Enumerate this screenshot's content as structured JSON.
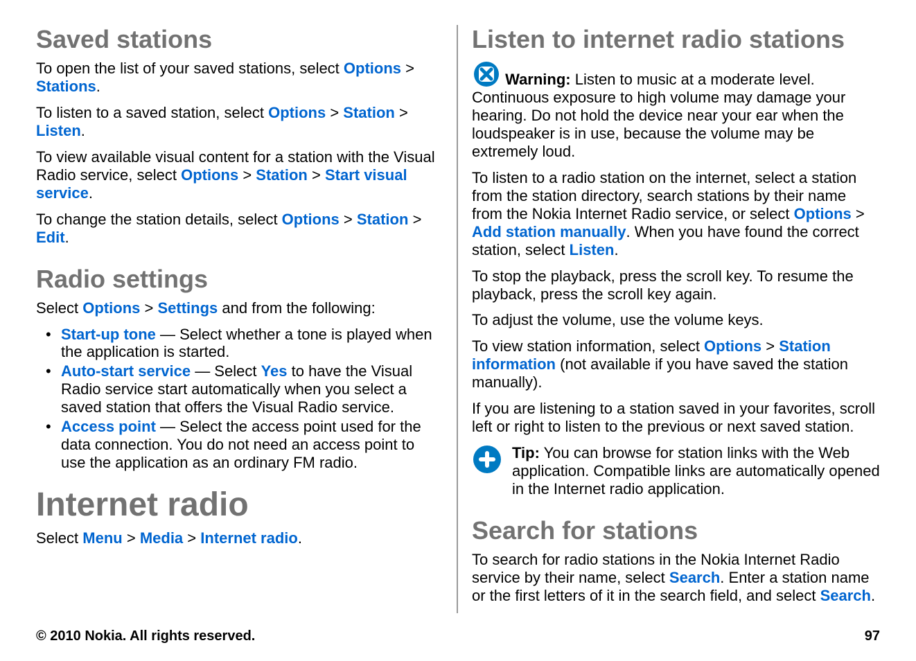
{
  "left": {
    "savedStations": {
      "heading": "Saved stations",
      "p1": {
        "a": "To open the list of your saved stations, select ",
        "options": "Options",
        "sep": " > ",
        "stations": "Stations",
        "dot": "."
      },
      "p2": {
        "a": "To listen to a saved station, select ",
        "options": "Options",
        "sep": " > ",
        "station": "Station",
        "sep2": " > ",
        "listen": "Listen",
        "dot": "."
      },
      "p3": {
        "a": "To view available visual content for a station with the Visual Radio service, select ",
        "options": "Options",
        "sep": " > ",
        "station": "Station",
        "sep2": " > ",
        "startVisual": "Start visual service",
        "dot": "."
      },
      "p4": {
        "a": "To change the station details, select ",
        "options": "Options",
        "sep": " > ",
        "station": "Station",
        "sep2": " > ",
        "edit": "Edit",
        "dot": "."
      }
    },
    "radioSettings": {
      "heading": "Radio settings",
      "intro": {
        "a": "Select ",
        "options": "Options",
        "sep": " > ",
        "settings": "Settings",
        "b": " and from the following:"
      },
      "items": [
        {
          "name": "Start-up tone",
          "desc": "  — Select whether a tone is played when the application is started."
        },
        {
          "name": "Auto-start service",
          "descA": "  — Select ",
          "yes": "Yes",
          "descB": " to have the Visual Radio service start automatically when you select a saved station that offers the Visual Radio service."
        },
        {
          "name": "Access point",
          "desc": "  — Select the access point used for the data connection. You do not need an access point to use the application as an ordinary FM radio."
        }
      ]
    },
    "internetRadio": {
      "heading": "Internet radio",
      "intro": {
        "a": "Select ",
        "menu": "Menu",
        "sep": " > ",
        "media": "Media",
        "sep2": " > ",
        "ir": "Internet radio",
        "dot": "."
      }
    }
  },
  "right": {
    "listen": {
      "heading": "Listen to internet radio stations",
      "warning": {
        "label": "Warning:",
        "text": "  Listen to music at a moderate level. Continuous exposure to high volume may damage your hearing. Do not hold the device near your ear when the loudspeaker is in use, because the volume may be extremely loud."
      },
      "p1": {
        "a": "To listen to a radio station on the internet, select a station from the station directory, search stations by their name from the Nokia Internet Radio service, or select ",
        "options": "Options",
        "sep": " > ",
        "addManual": "Add station manually",
        "b": ". When you have found the correct station, select ",
        "listen": "Listen",
        "dot": "."
      },
      "p2": "To stop the playback, press the scroll key. To resume the playback, press the scroll key again.",
      "p3": "To adjust the volume, use the volume keys.",
      "p4": {
        "a": "To view station information, select ",
        "options": "Options",
        "sep": " > ",
        "stationInfo": "Station information",
        "b": " (not available if you have saved the station manually)."
      },
      "p5": "If you are listening to a station saved in your favorites, scroll left or right to listen to the previous or next saved station.",
      "tip": {
        "label": "Tip:",
        "text": " You can browse for station links with the Web application. Compatible links are automatically opened in the Internet radio application."
      }
    },
    "search": {
      "heading": "Search for stations",
      "p": {
        "a": "To search for radio stations in the Nokia Internet Radio service by their name, select ",
        "search1": "Search",
        "b": ". Enter a station name or the first letters of it in the search field, and select ",
        "search2": "Search",
        "dot": "."
      }
    }
  },
  "footer": {
    "copyright": "© 2010 Nokia. All rights reserved.",
    "page": "97"
  }
}
